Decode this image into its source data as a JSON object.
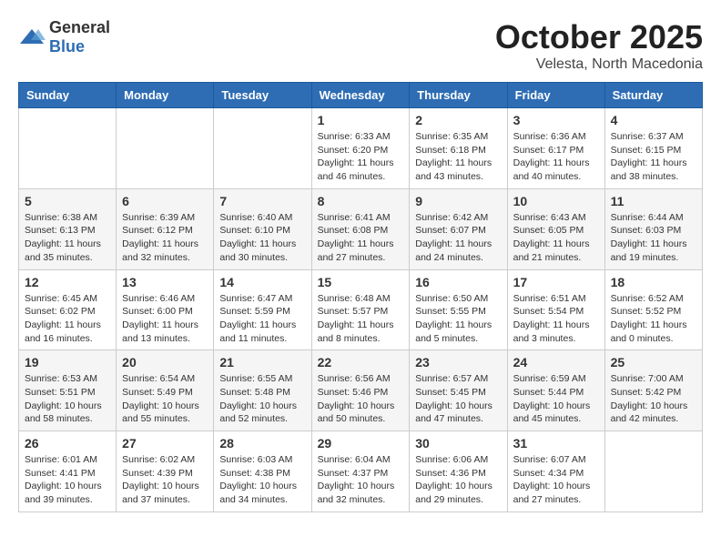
{
  "header": {
    "logo_general": "General",
    "logo_blue": "Blue",
    "month": "October 2025",
    "location": "Velesta, North Macedonia"
  },
  "weekdays": [
    "Sunday",
    "Monday",
    "Tuesday",
    "Wednesday",
    "Thursday",
    "Friday",
    "Saturday"
  ],
  "weeks": [
    [
      {
        "day": "",
        "info": ""
      },
      {
        "day": "",
        "info": ""
      },
      {
        "day": "",
        "info": ""
      },
      {
        "day": "1",
        "info": "Sunrise: 6:33 AM\nSunset: 6:20 PM\nDaylight: 11 hours and 46 minutes."
      },
      {
        "day": "2",
        "info": "Sunrise: 6:35 AM\nSunset: 6:18 PM\nDaylight: 11 hours and 43 minutes."
      },
      {
        "day": "3",
        "info": "Sunrise: 6:36 AM\nSunset: 6:17 PM\nDaylight: 11 hours and 40 minutes."
      },
      {
        "day": "4",
        "info": "Sunrise: 6:37 AM\nSunset: 6:15 PM\nDaylight: 11 hours and 38 minutes."
      }
    ],
    [
      {
        "day": "5",
        "info": "Sunrise: 6:38 AM\nSunset: 6:13 PM\nDaylight: 11 hours and 35 minutes."
      },
      {
        "day": "6",
        "info": "Sunrise: 6:39 AM\nSunset: 6:12 PM\nDaylight: 11 hours and 32 minutes."
      },
      {
        "day": "7",
        "info": "Sunrise: 6:40 AM\nSunset: 6:10 PM\nDaylight: 11 hours and 30 minutes."
      },
      {
        "day": "8",
        "info": "Sunrise: 6:41 AM\nSunset: 6:08 PM\nDaylight: 11 hours and 27 minutes."
      },
      {
        "day": "9",
        "info": "Sunrise: 6:42 AM\nSunset: 6:07 PM\nDaylight: 11 hours and 24 minutes."
      },
      {
        "day": "10",
        "info": "Sunrise: 6:43 AM\nSunset: 6:05 PM\nDaylight: 11 hours and 21 minutes."
      },
      {
        "day": "11",
        "info": "Sunrise: 6:44 AM\nSunset: 6:03 PM\nDaylight: 11 hours and 19 minutes."
      }
    ],
    [
      {
        "day": "12",
        "info": "Sunrise: 6:45 AM\nSunset: 6:02 PM\nDaylight: 11 hours and 16 minutes."
      },
      {
        "day": "13",
        "info": "Sunrise: 6:46 AM\nSunset: 6:00 PM\nDaylight: 11 hours and 13 minutes."
      },
      {
        "day": "14",
        "info": "Sunrise: 6:47 AM\nSunset: 5:59 PM\nDaylight: 11 hours and 11 minutes."
      },
      {
        "day": "15",
        "info": "Sunrise: 6:48 AM\nSunset: 5:57 PM\nDaylight: 11 hours and 8 minutes."
      },
      {
        "day": "16",
        "info": "Sunrise: 6:50 AM\nSunset: 5:55 PM\nDaylight: 11 hours and 5 minutes."
      },
      {
        "day": "17",
        "info": "Sunrise: 6:51 AM\nSunset: 5:54 PM\nDaylight: 11 hours and 3 minutes."
      },
      {
        "day": "18",
        "info": "Sunrise: 6:52 AM\nSunset: 5:52 PM\nDaylight: 11 hours and 0 minutes."
      }
    ],
    [
      {
        "day": "19",
        "info": "Sunrise: 6:53 AM\nSunset: 5:51 PM\nDaylight: 10 hours and 58 minutes."
      },
      {
        "day": "20",
        "info": "Sunrise: 6:54 AM\nSunset: 5:49 PM\nDaylight: 10 hours and 55 minutes."
      },
      {
        "day": "21",
        "info": "Sunrise: 6:55 AM\nSunset: 5:48 PM\nDaylight: 10 hours and 52 minutes."
      },
      {
        "day": "22",
        "info": "Sunrise: 6:56 AM\nSunset: 5:46 PM\nDaylight: 10 hours and 50 minutes."
      },
      {
        "day": "23",
        "info": "Sunrise: 6:57 AM\nSunset: 5:45 PM\nDaylight: 10 hours and 47 minutes."
      },
      {
        "day": "24",
        "info": "Sunrise: 6:59 AM\nSunset: 5:44 PM\nDaylight: 10 hours and 45 minutes."
      },
      {
        "day": "25",
        "info": "Sunrise: 7:00 AM\nSunset: 5:42 PM\nDaylight: 10 hours and 42 minutes."
      }
    ],
    [
      {
        "day": "26",
        "info": "Sunrise: 6:01 AM\nSunset: 4:41 PM\nDaylight: 10 hours and 39 minutes."
      },
      {
        "day": "27",
        "info": "Sunrise: 6:02 AM\nSunset: 4:39 PM\nDaylight: 10 hours and 37 minutes."
      },
      {
        "day": "28",
        "info": "Sunrise: 6:03 AM\nSunset: 4:38 PM\nDaylight: 10 hours and 34 minutes."
      },
      {
        "day": "29",
        "info": "Sunrise: 6:04 AM\nSunset: 4:37 PM\nDaylight: 10 hours and 32 minutes."
      },
      {
        "day": "30",
        "info": "Sunrise: 6:06 AM\nSunset: 4:36 PM\nDaylight: 10 hours and 29 minutes."
      },
      {
        "day": "31",
        "info": "Sunrise: 6:07 AM\nSunset: 4:34 PM\nDaylight: 10 hours and 27 minutes."
      },
      {
        "day": "",
        "info": ""
      }
    ]
  ]
}
